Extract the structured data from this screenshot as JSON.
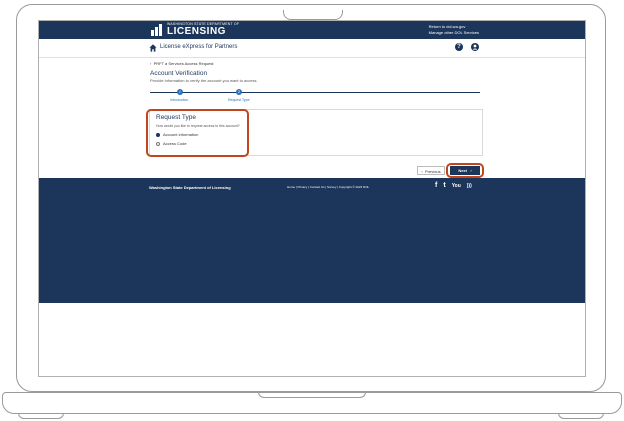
{
  "header": {
    "logo_small": "WASHINGTON STATE DEPARTMENT OF",
    "logo_big": "LICENSING",
    "link_dol": "Return to dol.wa.gov",
    "link_services": "Manage other DOL Services"
  },
  "subheader": {
    "app_title": "License eXpress for Partners",
    "help_glyph": "?",
    "user_glyph": "●"
  },
  "breadcrumb": "PRFT a Services Access Request",
  "page": {
    "title": "Account Verification",
    "description": "Provide information to verify the account you want to access."
  },
  "stepper": {
    "steps": [
      {
        "label": "Introduction",
        "glyph": "✓"
      },
      {
        "label": "Request Type",
        "glyph": "2"
      }
    ]
  },
  "request_card": {
    "title": "Request Type",
    "question": "How would you like to request access to this account?",
    "options": [
      {
        "label": "Account information",
        "selected": true
      },
      {
        "label": "Access Code",
        "selected": false
      }
    ]
  },
  "buttons": {
    "previous": "Previous",
    "next": "Next",
    "prev_arrow": "‹",
    "next_arrow": "›"
  },
  "footer": {
    "name": "Washington State Department of Licensing",
    "links": "Home | Privacy | Contact Us | Survey | Copyright © 2023 DOL",
    "social": [
      "f",
      "t",
      "You",
      ")))"
    ]
  },
  "colors": {
    "navy": "#1b355b",
    "accent_blue": "#2a72c0",
    "highlight_orange": "#c1461d"
  }
}
